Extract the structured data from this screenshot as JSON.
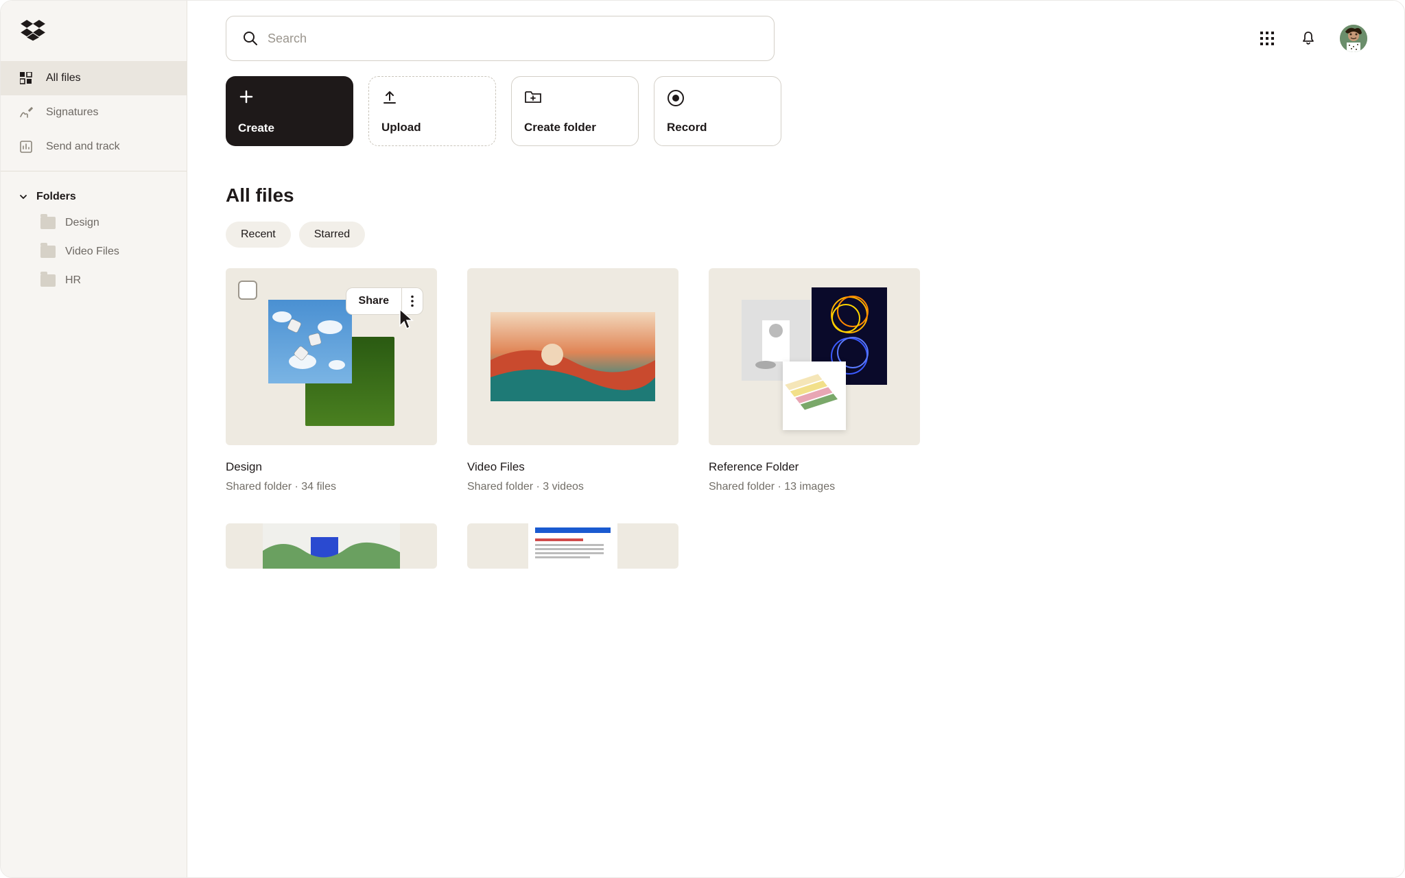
{
  "search": {
    "placeholder": "Search"
  },
  "sidebar": {
    "items": [
      {
        "label": "All files"
      },
      {
        "label": "Signatures"
      },
      {
        "label": "Send and track"
      }
    ],
    "folders_label": "Folders",
    "folders": [
      {
        "label": "Design"
      },
      {
        "label": "Video Files"
      },
      {
        "label": "HR"
      }
    ]
  },
  "actions": {
    "create": "Create",
    "upload": "Upload",
    "create_folder": "Create folder",
    "record": "Record"
  },
  "page_title": "All files",
  "chips": {
    "recent": "Recent",
    "starred": "Starred"
  },
  "hover": {
    "share_label": "Share"
  },
  "files": [
    {
      "title": "Design",
      "subtitle": "Shared folder · 34 files"
    },
    {
      "title": "Video Files",
      "subtitle": "Shared folder · 3 videos"
    },
    {
      "title": "Reference Folder",
      "subtitle": "Shared folder · 13 images"
    }
  ]
}
